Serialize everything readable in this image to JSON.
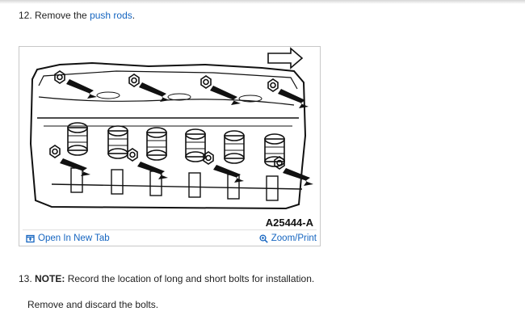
{
  "step12": {
    "prefix": "12. Remove the ",
    "link": "push rods",
    "suffix": "."
  },
  "figure": {
    "code": "A25444-A",
    "open_tab_label": "Open In New Tab",
    "zoom_label": "Zoom/Print"
  },
  "step13": {
    "prefix": "13. ",
    "note_label": "NOTE:",
    "text": " Record the location of long and short bolts for installation.",
    "subtext": "Remove and discard the bolts."
  },
  "colors": {
    "link": "#1565c0",
    "text": "#222222"
  }
}
